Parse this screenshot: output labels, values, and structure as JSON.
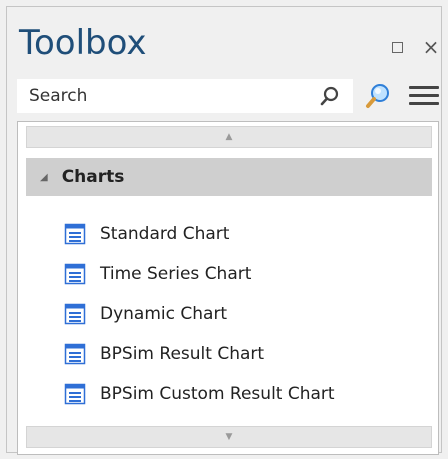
{
  "window": {
    "title": "Toolbox",
    "restore_icon": "restore-window-icon",
    "close_icon": "close-icon",
    "close_glyph": "×"
  },
  "search": {
    "placeholder": "Search",
    "value": ""
  },
  "icons": {
    "search": "magnifier-icon",
    "find": "find-toolbox-item-icon",
    "menu": "hamburger-menu-icon"
  },
  "scroll": {
    "up_glyph": "▲",
    "down_glyph": "▼"
  },
  "category": {
    "label": "Charts",
    "expanded_glyph": "◢"
  },
  "items": [
    {
      "label": "Standard Chart",
      "icon": "chart-element-icon"
    },
    {
      "label": "Time Series Chart",
      "icon": "chart-element-icon"
    },
    {
      "label": "Dynamic Chart",
      "icon": "chart-element-icon"
    },
    {
      "label": "BPSim Result Chart",
      "icon": "chart-element-icon"
    },
    {
      "label": "BPSim Custom Result Chart",
      "icon": "chart-element-icon"
    }
  ],
  "colors": {
    "title": "#1f4e79",
    "category_bg": "#cfcfcf",
    "icon_blue": "#2f6fd6"
  }
}
